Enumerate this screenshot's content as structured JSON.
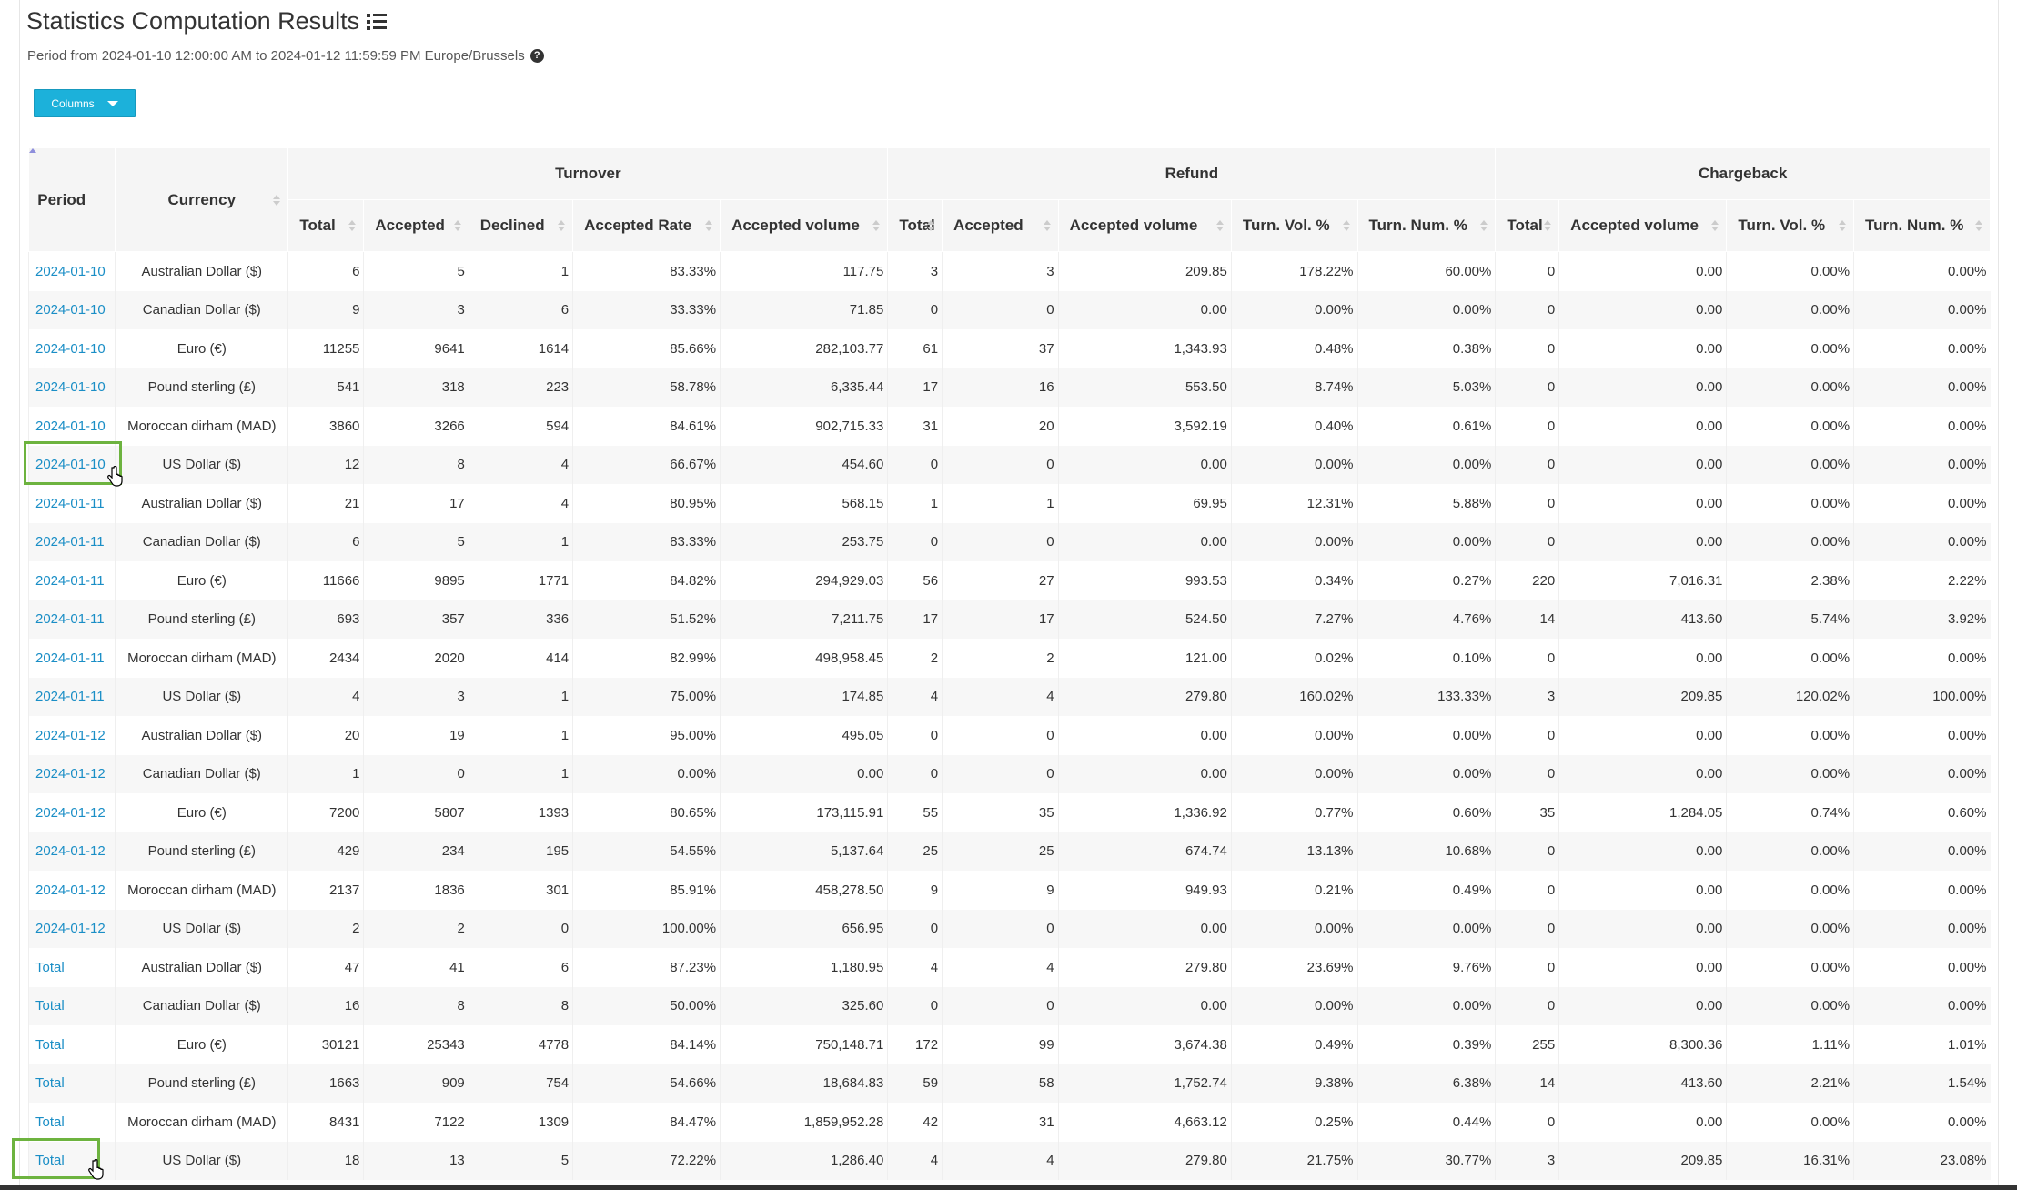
{
  "page": {
    "title": "Statistics Computation Results",
    "title_icon": "list-icon",
    "period_text": "Period from 2024-01-10 12:00:00 AM to 2024-01-12 11:59:59 PM Europe/Brussels",
    "help_icon": "question-circle-icon",
    "columns_button": "Columns"
  },
  "table": {
    "groups": [
      "Turnover",
      "Refund",
      "Chargeback"
    ],
    "headers": {
      "period": "Period",
      "currency": "Currency",
      "turnover": [
        "Total",
        "Accepted",
        "Declined",
        "Accepted Rate",
        "Accepted volume"
      ],
      "refund": [
        "Total",
        "Accepted",
        "Accepted volume",
        "Turn. Vol. %",
        "Turn. Num. %"
      ],
      "chargeback": [
        "Total",
        "Accepted volume",
        "Turn. Vol. %",
        "Turn. Num. %"
      ]
    },
    "sorted_column": "Period",
    "rows": [
      [
        "2024-01-10",
        "Australian Dollar ($)",
        "6",
        "5",
        "1",
        "83.33%",
        "117.75",
        "3",
        "3",
        "209.85",
        "178.22%",
        "60.00%",
        "0",
        "0.00",
        "0.00%",
        "0.00%"
      ],
      [
        "2024-01-10",
        "Canadian Dollar ($)",
        "9",
        "3",
        "6",
        "33.33%",
        "71.85",
        "0",
        "0",
        "0.00",
        "0.00%",
        "0.00%",
        "0",
        "0.00",
        "0.00%",
        "0.00%"
      ],
      [
        "2024-01-10",
        "Euro (€)",
        "11255",
        "9641",
        "1614",
        "85.66%",
        "282,103.77",
        "61",
        "37",
        "1,343.93",
        "0.48%",
        "0.38%",
        "0",
        "0.00",
        "0.00%",
        "0.00%"
      ],
      [
        "2024-01-10",
        "Pound sterling (£)",
        "541",
        "318",
        "223",
        "58.78%",
        "6,335.44",
        "17",
        "16",
        "553.50",
        "8.74%",
        "5.03%",
        "0",
        "0.00",
        "0.00%",
        "0.00%"
      ],
      [
        "2024-01-10",
        "Moroccan dirham (MAD)",
        "3860",
        "3266",
        "594",
        "84.61%",
        "902,715.33",
        "31",
        "20",
        "3,592.19",
        "0.40%",
        "0.61%",
        "0",
        "0.00",
        "0.00%",
        "0.00%"
      ],
      [
        "2024-01-10",
        "US Dollar ($)",
        "12",
        "8",
        "4",
        "66.67%",
        "454.60",
        "0",
        "0",
        "0.00",
        "0.00%",
        "0.00%",
        "0",
        "0.00",
        "0.00%",
        "0.00%"
      ],
      [
        "2024-01-11",
        "Australian Dollar ($)",
        "21",
        "17",
        "4",
        "80.95%",
        "568.15",
        "1",
        "1",
        "69.95",
        "12.31%",
        "5.88%",
        "0",
        "0.00",
        "0.00%",
        "0.00%"
      ],
      [
        "2024-01-11",
        "Canadian Dollar ($)",
        "6",
        "5",
        "1",
        "83.33%",
        "253.75",
        "0",
        "0",
        "0.00",
        "0.00%",
        "0.00%",
        "0",
        "0.00",
        "0.00%",
        "0.00%"
      ],
      [
        "2024-01-11",
        "Euro (€)",
        "11666",
        "9895",
        "1771",
        "84.82%",
        "294,929.03",
        "56",
        "27",
        "993.53",
        "0.34%",
        "0.27%",
        "220",
        "7,016.31",
        "2.38%",
        "2.22%"
      ],
      [
        "2024-01-11",
        "Pound sterling (£)",
        "693",
        "357",
        "336",
        "51.52%",
        "7,211.75",
        "17",
        "17",
        "524.50",
        "7.27%",
        "4.76%",
        "14",
        "413.60",
        "5.74%",
        "3.92%"
      ],
      [
        "2024-01-11",
        "Moroccan dirham (MAD)",
        "2434",
        "2020",
        "414",
        "82.99%",
        "498,958.45",
        "2",
        "2",
        "121.00",
        "0.02%",
        "0.10%",
        "0",
        "0.00",
        "0.00%",
        "0.00%"
      ],
      [
        "2024-01-11",
        "US Dollar ($)",
        "4",
        "3",
        "1",
        "75.00%",
        "174.85",
        "4",
        "4",
        "279.80",
        "160.02%",
        "133.33%",
        "3",
        "209.85",
        "120.02%",
        "100.00%"
      ],
      [
        "2024-01-12",
        "Australian Dollar ($)",
        "20",
        "19",
        "1",
        "95.00%",
        "495.05",
        "0",
        "0",
        "0.00",
        "0.00%",
        "0.00%",
        "0",
        "0.00",
        "0.00%",
        "0.00%"
      ],
      [
        "2024-01-12",
        "Canadian Dollar ($)",
        "1",
        "0",
        "1",
        "0.00%",
        "0.00",
        "0",
        "0",
        "0.00",
        "0.00%",
        "0.00%",
        "0",
        "0.00",
        "0.00%",
        "0.00%"
      ],
      [
        "2024-01-12",
        "Euro (€)",
        "7200",
        "5807",
        "1393",
        "80.65%",
        "173,115.91",
        "55",
        "35",
        "1,336.92",
        "0.77%",
        "0.60%",
        "35",
        "1,284.05",
        "0.74%",
        "0.60%"
      ],
      [
        "2024-01-12",
        "Pound sterling (£)",
        "429",
        "234",
        "195",
        "54.55%",
        "5,137.64",
        "25",
        "25",
        "674.74",
        "13.13%",
        "10.68%",
        "0",
        "0.00",
        "0.00%",
        "0.00%"
      ],
      [
        "2024-01-12",
        "Moroccan dirham (MAD)",
        "2137",
        "1836",
        "301",
        "85.91%",
        "458,278.50",
        "9",
        "9",
        "949.93",
        "0.21%",
        "0.49%",
        "0",
        "0.00",
        "0.00%",
        "0.00%"
      ],
      [
        "2024-01-12",
        "US Dollar ($)",
        "2",
        "2",
        "0",
        "100.00%",
        "656.95",
        "0",
        "0",
        "0.00",
        "0.00%",
        "0.00%",
        "0",
        "0.00",
        "0.00%",
        "0.00%"
      ],
      [
        "Total",
        "Australian Dollar ($)",
        "47",
        "41",
        "6",
        "87.23%",
        "1,180.95",
        "4",
        "4",
        "279.80",
        "23.69%",
        "9.76%",
        "0",
        "0.00",
        "0.00%",
        "0.00%"
      ],
      [
        "Total",
        "Canadian Dollar ($)",
        "16",
        "8",
        "8",
        "50.00%",
        "325.60",
        "0",
        "0",
        "0.00",
        "0.00%",
        "0.00%",
        "0",
        "0.00",
        "0.00%",
        "0.00%"
      ],
      [
        "Total",
        "Euro (€)",
        "30121",
        "25343",
        "4778",
        "84.14%",
        "750,148.71",
        "172",
        "99",
        "3,674.38",
        "0.49%",
        "0.39%",
        "255",
        "8,300.36",
        "1.11%",
        "1.01%"
      ],
      [
        "Total",
        "Pound sterling (£)",
        "1663",
        "909",
        "754",
        "54.66%",
        "18,684.83",
        "59",
        "58",
        "1,752.74",
        "9.38%",
        "6.38%",
        "14",
        "413.60",
        "2.21%",
        "1.54%"
      ],
      [
        "Total",
        "Moroccan dirham (MAD)",
        "8431",
        "7122",
        "1309",
        "84.47%",
        "1,859,952.28",
        "42",
        "31",
        "4,663.12",
        "0.25%",
        "0.44%",
        "0",
        "0.00",
        "0.00%",
        "0.00%"
      ],
      [
        "Total",
        "US Dollar ($)",
        "18",
        "13",
        "5",
        "72.22%",
        "1,286.40",
        "4",
        "4",
        "279.80",
        "21.75%",
        "30.77%",
        "3",
        "209.85",
        "16.31%",
        "23.08%"
      ]
    ]
  },
  "colors": {
    "accent_button": "#1cb1da",
    "link": "#1a8ec6",
    "highlight_box": "#6db33f",
    "header_bg": "#f5f5f5"
  }
}
